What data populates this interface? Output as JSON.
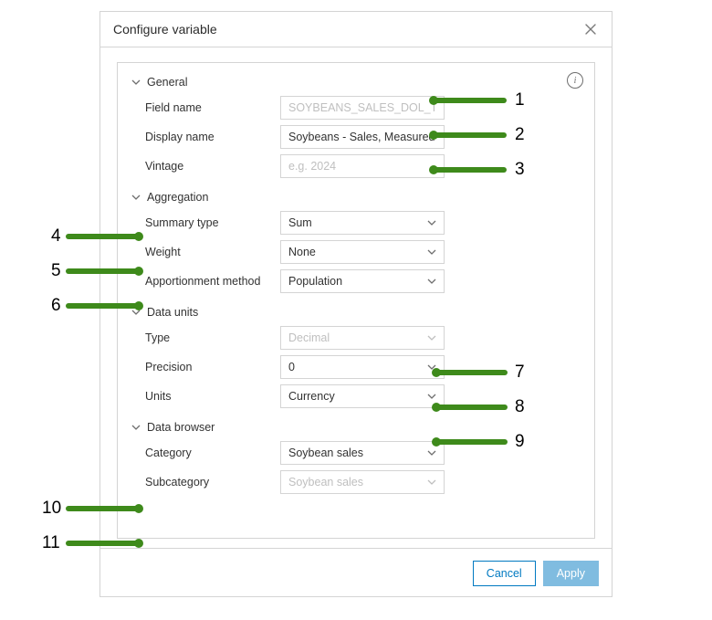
{
  "dialog": {
    "title": "Configure variable",
    "cancel": "Cancel",
    "apply": "Apply"
  },
  "sections": {
    "general": {
      "title": "General",
      "field_name_label": "Field name",
      "field_name_value": "SOYBEANS_SALES_DOL_TOTAL",
      "display_name_label": "Display name",
      "display_name_value": "Soybeans - Sales, Measured In $ - Total",
      "vintage_label": "Vintage",
      "vintage_placeholder": "e.g. 2024",
      "vintage_value": ""
    },
    "aggregation": {
      "title": "Aggregation",
      "summary_type_label": "Summary type",
      "summary_type_value": "Sum",
      "weight_label": "Weight",
      "weight_value": "None",
      "apportionment_label": "Apportionment method",
      "apportionment_value": "Population"
    },
    "data_units": {
      "title": "Data units",
      "type_label": "Type",
      "type_value": "Decimal",
      "precision_label": "Precision",
      "precision_value": "0",
      "units_label": "Units",
      "units_value": "Currency"
    },
    "data_browser": {
      "title": "Data browser",
      "category_label": "Category",
      "category_value": "Soybean sales",
      "subcategory_label": "Subcategory",
      "subcategory_value": "Soybean sales"
    }
  },
  "annotations": {
    "n1": "1",
    "n2": "2",
    "n3": "3",
    "n4": "4",
    "n5": "5",
    "n6": "6",
    "n7": "7",
    "n8": "8",
    "n9": "9",
    "n10": "10",
    "n11": "11"
  }
}
